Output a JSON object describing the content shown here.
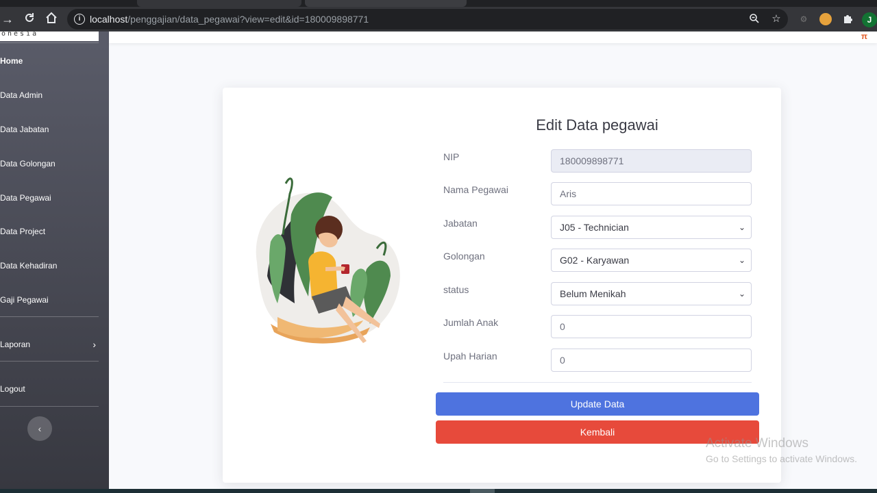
{
  "browser": {
    "url_host": "localhost",
    "url_path": "/penggajian/data_pegawai?view=edit&id=180009898771",
    "avatar_letter": "J"
  },
  "sidebar": {
    "brand_text": "onesia",
    "items": [
      {
        "label": "Home"
      },
      {
        "label": "Data Admin"
      },
      {
        "label": "Data Jabatan"
      },
      {
        "label": "Data Golongan"
      },
      {
        "label": "Data Pegawai"
      },
      {
        "label": "Data Project"
      },
      {
        "label": "Data Kehadiran"
      },
      {
        "label": "Gaji Pegawai"
      },
      {
        "label": "Laporan"
      },
      {
        "label": "Logout"
      }
    ]
  },
  "form": {
    "title": "Edit Data pegawai",
    "nip_label": "NIP",
    "nip_value": "180009898771",
    "nama_label": "Nama Pegawai",
    "nama_value": "Aris",
    "jabatan_label": "Jabatan",
    "jabatan_value": "J05 - Technician",
    "golongan_label": "Golongan",
    "golongan_value": "G02 - Karyawan",
    "status_label": "status",
    "status_value": "Belum Menikah",
    "anak_label": "Jumlah Anak",
    "anak_value": "0",
    "upah_label": "Upah Harian",
    "upah_value": "0",
    "update_label": "Update Data",
    "back_label": "Kembali"
  },
  "watermark": {
    "line1": "Activate Windows",
    "line2": "Go to Settings to activate Windows."
  },
  "colors": {
    "primary": "#4e73df",
    "danger": "#e74a3b",
    "sidebar": "#4e4f5a"
  }
}
